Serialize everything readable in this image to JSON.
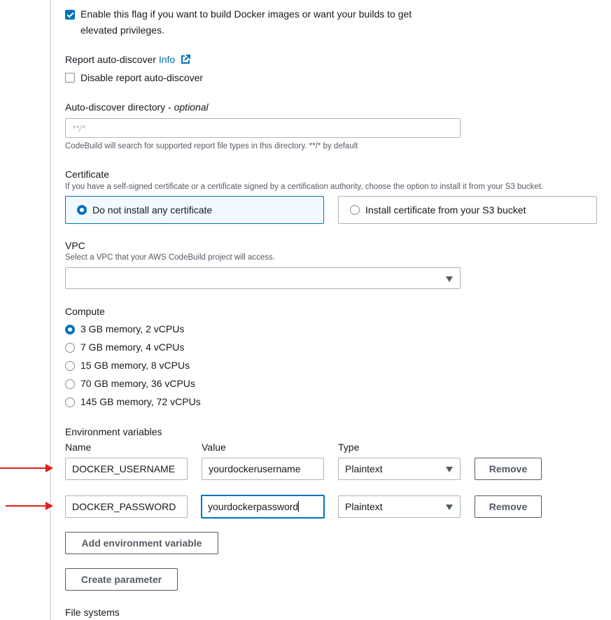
{
  "privileged": {
    "checked": true,
    "label_line1": "Enable this flag if you want to build Docker images or want your builds to get",
    "label_line2": "elevated privileges."
  },
  "report_auto_discover": {
    "title": "Report auto-discover",
    "info_link": "Info",
    "info_icon": "external-link-icon",
    "checkbox_label": "Disable report auto-discover",
    "checked": false
  },
  "auto_discover_directory": {
    "label": "Auto-discover directory - ",
    "optional": "optional",
    "value": "",
    "placeholder": "**/*",
    "help": "CodeBuild will search for supported report file types in this directory. **/* by default"
  },
  "certificate": {
    "title": "Certificate",
    "description": "If you have a self-signed certificate or a certificate signed by a certification authority, choose the option to install it from your S3 bucket.",
    "options": [
      {
        "label": "Do not install any certificate",
        "selected": true
      },
      {
        "label": "Install certificate from your S3 bucket",
        "selected": false
      }
    ]
  },
  "vpc": {
    "title": "VPC",
    "description": "Select a VPC that your AWS CodeBuild project will access.",
    "selected": ""
  },
  "compute": {
    "title": "Compute",
    "options": [
      {
        "label": "3 GB memory, 2 vCPUs",
        "selected": true
      },
      {
        "label": "7 GB memory, 4 vCPUs",
        "selected": false
      },
      {
        "label": "15 GB memory, 8 vCPUs",
        "selected": false
      },
      {
        "label": "70 GB memory, 36 vCPUs",
        "selected": false
      },
      {
        "label": "145 GB memory, 72 vCPUs",
        "selected": false
      }
    ]
  },
  "environment_variables": {
    "title": "Environment variables",
    "headers": {
      "name": "Name",
      "value": "Value",
      "type": "Type"
    },
    "rows": [
      {
        "name": "DOCKER_USERNAME",
        "value": "yourdockerusername",
        "type": "Plaintext",
        "remove_label": "Remove"
      },
      {
        "name": "DOCKER_PASSWORD",
        "value": "yourdockerpassword",
        "type": "Plaintext",
        "remove_label": "Remove"
      }
    ],
    "add_button": "Add environment variable",
    "create_parameter_button": "Create parameter"
  },
  "file_systems": {
    "title": "File systems"
  },
  "annotations": {
    "arrow_color": "#e0201c"
  },
  "colors": {
    "accent": "#0073bb",
    "text": "#16191f",
    "secondary_text": "#545b64",
    "border": "#aab7b8"
  }
}
